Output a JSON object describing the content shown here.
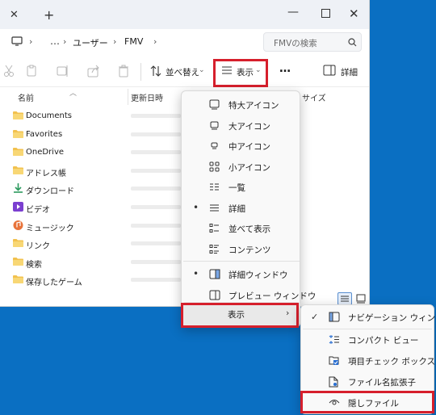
{
  "address": {
    "ellipsis": "…",
    "crumbs": [
      "ユーザー",
      "FMV"
    ],
    "search_placeholder": "FMVの検索"
  },
  "toolbar": {
    "sort_label": "並べ替え",
    "view_label": "表示",
    "more_label": "…",
    "details_label": "詳細"
  },
  "columns": {
    "name": "名前",
    "modified": "更新日時",
    "size": "サイズ"
  },
  "files": [
    {
      "name": "Documents",
      "icon": "folder-icon"
    },
    {
      "name": "Favorites",
      "icon": "folder-icon"
    },
    {
      "name": "OneDrive",
      "icon": "folder-icon"
    },
    {
      "name": "アドレス帳",
      "icon": "folder-icon"
    },
    {
      "name": "ダウンロード",
      "icon": "download-folder-icon"
    },
    {
      "name": "ビデオ",
      "icon": "video-folder-icon"
    },
    {
      "name": "ミュージック",
      "icon": "music-folder-icon"
    },
    {
      "name": "リンク",
      "icon": "folder-icon"
    },
    {
      "name": "検索",
      "icon": "folder-icon"
    },
    {
      "name": "保存したゲーム",
      "icon": "folder-icon"
    }
  ],
  "view_menu": {
    "items": [
      {
        "label": "特大アイコン",
        "icon": "extra-large-icons-icon",
        "selected": false
      },
      {
        "label": "大アイコン",
        "icon": "large-icons-icon",
        "selected": false
      },
      {
        "label": "中アイコン",
        "icon": "medium-icons-icon",
        "selected": false
      },
      {
        "label": "小アイコン",
        "icon": "small-icons-icon",
        "selected": false
      },
      {
        "label": "一覧",
        "icon": "list-icon",
        "selected": false
      },
      {
        "label": "詳細",
        "icon": "details-icon",
        "selected": true
      },
      {
        "label": "並べて表示",
        "icon": "tiles-icon",
        "selected": false
      },
      {
        "label": "コンテンツ",
        "icon": "content-icon",
        "selected": false
      }
    ],
    "panes": [
      {
        "label": "詳細ウィンドウ",
        "icon": "details-pane-icon",
        "selected": true
      },
      {
        "label": "プレビュー ウィンドウ",
        "icon": "preview-pane-icon",
        "selected": false
      }
    ],
    "show_label": "表示"
  },
  "show_submenu": {
    "items": [
      {
        "label": "ナビゲーション ウィンドウ",
        "icon": "navigation-pane-icon",
        "checked": true
      },
      {
        "label": "コンパクト ビュー",
        "icon": "compact-view-icon",
        "checked": false
      },
      {
        "label": "項目チェック ボックス",
        "icon": "item-checkbox-icon",
        "checked": false
      },
      {
        "label": "ファイル名拡張子",
        "icon": "file-extension-icon",
        "checked": false
      },
      {
        "label": "隠しファイル",
        "icon": "hidden-items-icon",
        "checked": false
      }
    ]
  },
  "colors": {
    "desktop": "#0a6fc2",
    "highlight": "#d61f2c",
    "folder": "#f2c14e"
  }
}
